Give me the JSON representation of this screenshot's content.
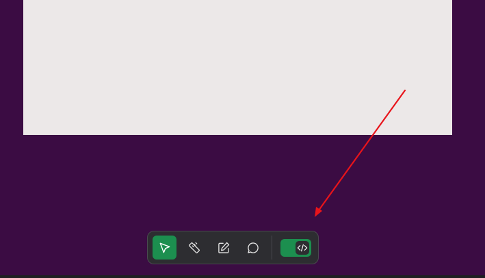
{
  "colors": {
    "background": "#3b0c43",
    "canvas": "#ece8e8",
    "toolbar_bg": "#2d2d31",
    "accent_green": "#1c8f4f",
    "arrow_red": "#e8141b"
  },
  "toolbar": {
    "tools": [
      {
        "icon": "pointer-icon",
        "active": true
      },
      {
        "icon": "ruler-icon",
        "active": false
      },
      {
        "icon": "edit-icon",
        "active": false
      },
      {
        "icon": "comment-icon",
        "active": false
      }
    ],
    "code_toggle": {
      "icon": "code-icon",
      "on": true
    }
  }
}
